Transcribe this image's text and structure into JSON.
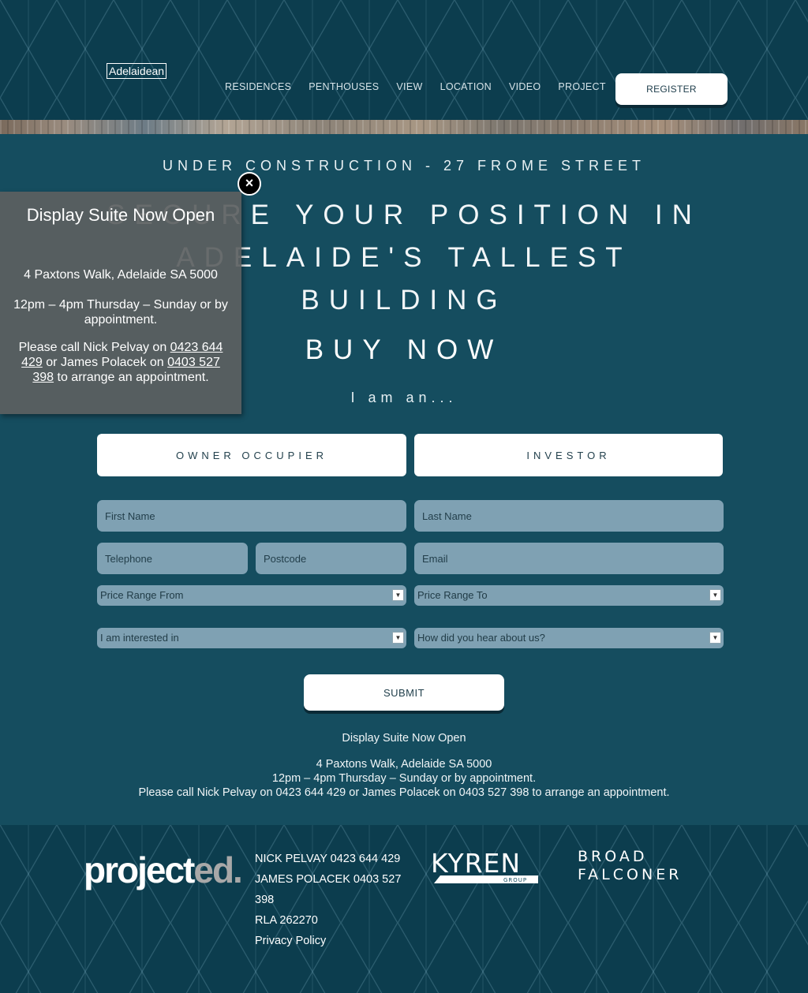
{
  "header": {
    "logo": "Adelaidean",
    "nav": [
      "RESIDENCES",
      "PENTHOUSES",
      "VIEW",
      "LOCATION",
      "VIDEO",
      "PROJECT"
    ],
    "register_label": "REGISTER"
  },
  "hero": {
    "kicker": "UNDER CONSTRUCTION -  27 FROME STREET",
    "headline": "SECURE YOUR POSITION IN ADELAIDE'S TALLEST BUILDING",
    "buy_now": "BUY NOW",
    "iam": "I am an..."
  },
  "form": {
    "owner_label": "OWNER OCCUPIER",
    "investor_label": "INVESTOR",
    "first_name": "First Name",
    "last_name": "Last Name",
    "telephone": "Telephone",
    "postcode": "Postcode",
    "email": "Email",
    "price_from": "Price Range From",
    "price_to": "Price Range To",
    "interested_in": "I am interested in",
    "hear_about": "How did you hear about us?",
    "submit_label": "SUBMIT"
  },
  "info": {
    "title": "Display Suite Now Open",
    "address": "4 Paxtons Walk, Adelaide SA 5000",
    "hours": "12pm – 4pm Thursday – Sunday or by appointment.",
    "call": "Please call Nick Pelvay on 0423 644 429 or James Polacek on 0403 527 398 to arrange an appointment."
  },
  "popup": {
    "title": "Display Suite Now Open",
    "address": "4 Paxtons Walk, Adelaide SA 5000",
    "hours": "12pm – 4pm Thursday – Sunday or by appointment.",
    "call_prefix": "Please call Nick Pelvay on ",
    "phone1": "0423 644 429",
    "call_mid": " or James Polacek on ",
    "phone2": "0403 527 398",
    "call_suffix": " to arrange an appointment.",
    "close": "×"
  },
  "footer": {
    "logo_main": "project",
    "logo_accent": "ed.",
    "contact1": "NICK PELVAY   0423 644 429",
    "contact2": "JAMES POLACEK   0403 527 398",
    "rla": "RLA 262270",
    "privacy": "Privacy Policy",
    "kyren": "KYREN",
    "kyren_sub": "GROUP",
    "broad_line1": "BROAD",
    "broad_line2": "FALCONER"
  },
  "colors": {
    "header_bg": "#0c3d4e",
    "main_bg": "#154d5f",
    "field_bg": "#7fa1b3",
    "popup_bg": "#5c6061"
  }
}
